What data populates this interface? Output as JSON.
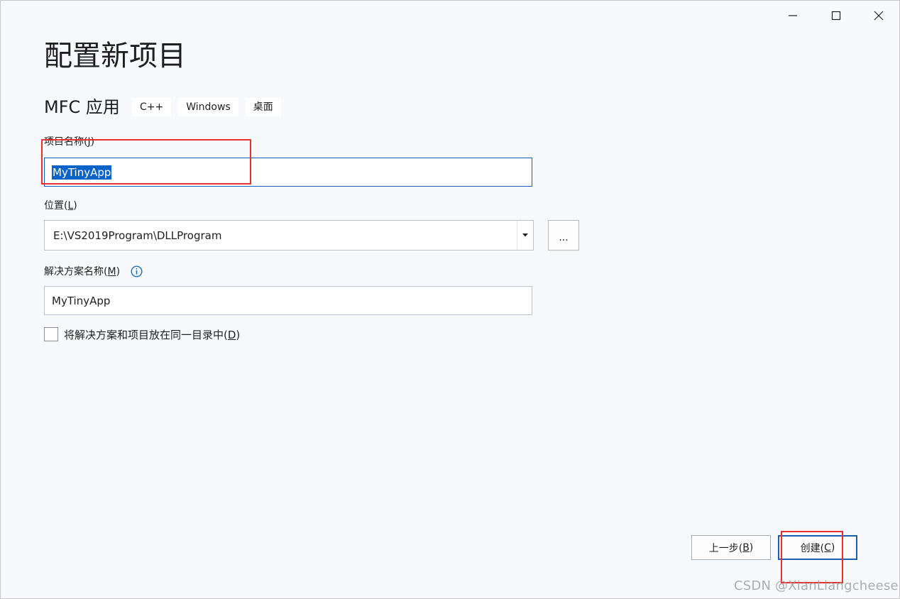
{
  "window": {
    "icons": {
      "minimize": "minimize-icon",
      "maximize": "maximize-icon",
      "close": "close-icon"
    }
  },
  "page": {
    "title": "配置新项目",
    "project_type": "MFC 应用",
    "tags": [
      "C++",
      "Windows",
      "桌面"
    ]
  },
  "project_name": {
    "label_prefix": "项目名称(",
    "label_hotkey": "J",
    "label_suffix": ")",
    "value": "MyTinyApp"
  },
  "location": {
    "label_prefix": "位置(",
    "label_hotkey": "L",
    "label_suffix": ")",
    "value": "E:\\VS2019Program\\DLLProgram",
    "browse_label": "..."
  },
  "solution_name": {
    "label_prefix": "解决方案名称(",
    "label_hotkey": "M",
    "label_suffix": ")",
    "value": "MyTinyApp",
    "info_icon": "info-icon"
  },
  "same_dir": {
    "label_prefix": "将解决方案和项目放在同一目录中(",
    "label_hotkey": "D",
    "label_suffix": ")",
    "checked": false
  },
  "buttons": {
    "back": {
      "prefix": "上一步(",
      "hotkey": "B",
      "suffix": ")"
    },
    "create": {
      "prefix": "创建(",
      "hotkey": "C",
      "suffix": ")"
    }
  },
  "watermark": "CSDN @XianLiangcheese",
  "colors": {
    "selection": "#0a64c8",
    "annotation": "#e8302f",
    "accent": "#1a5fb4"
  }
}
